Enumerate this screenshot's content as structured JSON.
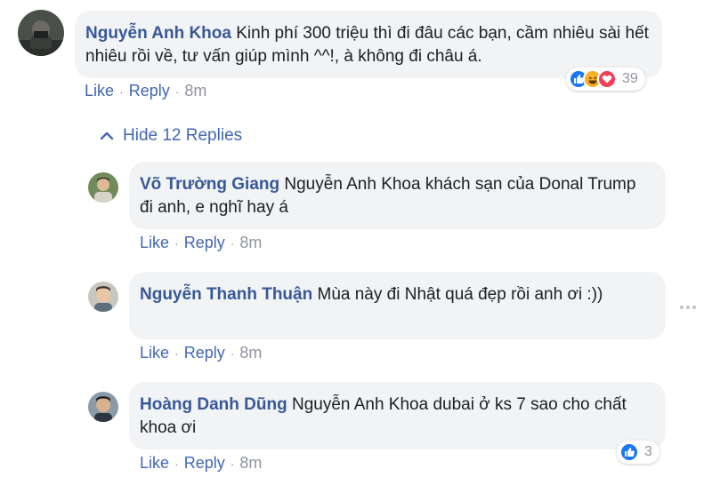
{
  "comment": {
    "author": "Nguyễn Anh Khoa",
    "text": "Kinh phí 300 triệu thì đi đâu các bạn, cầm nhiêu sài hết nhiêu rồi về, tư vấn giúp mình ^^!, à không đi châu á.",
    "like_label": "Like",
    "reply_label": "Reply",
    "time": "8m",
    "reactions": {
      "icons": [
        "like-icon",
        "haha-icon",
        "love-icon"
      ],
      "count": "39"
    }
  },
  "hide_replies_label": "Hide 12 Replies",
  "replies": [
    {
      "author": "Võ Trường Giang",
      "text": "Nguyễn Anh Khoa khách sạn của Donal Trump đi anh, e nghĩ hay á",
      "like_label": "Like",
      "reply_label": "Reply",
      "time": "8m"
    },
    {
      "author": "Nguyễn Thanh Thuận",
      "text": "Mùa này đi Nhật quá đẹp rồi anh ơi :))",
      "like_label": "Like",
      "reply_label": "Reply",
      "time": "8m"
    },
    {
      "author": "Hoàng Danh Dũng",
      "text": "Nguyễn Anh Khoa dubai ở ks 7 sao cho chất khoa ơi",
      "like_label": "Like",
      "reply_label": "Reply",
      "time": "8m",
      "reactions": {
        "icons": [
          "like-icon"
        ],
        "count": "3"
      }
    }
  ],
  "colors": {
    "author": "#385898",
    "link": "#4267b2",
    "bubble": "#f2f3f5",
    "meta": "#90949c",
    "like_reaction": "#1877f2",
    "haha_reaction": "#f7b125",
    "love_reaction": "#f33e58"
  }
}
